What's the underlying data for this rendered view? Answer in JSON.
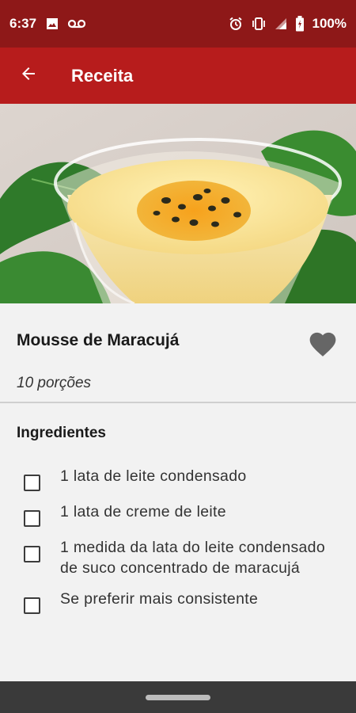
{
  "status_bar": {
    "time": "6:37",
    "battery": "100%",
    "icons": [
      "image-icon",
      "voicemail-icon",
      "alarm-icon",
      "vibrate-icon",
      "signal-icon",
      "battery-icon"
    ]
  },
  "app_bar": {
    "title": "Receita",
    "back_icon": "arrow-back-icon"
  },
  "recipe": {
    "title": "Mousse de Maracujá",
    "servings": "10 porções",
    "favorite_icon": "heart-icon"
  },
  "ingredients_section": {
    "title": "Ingredientes",
    "items": [
      {
        "text": "1 lata de leite condensado"
      },
      {
        "text": "1 lata de creme de leite"
      },
      {
        "text": "1 medida da lata do leite condensado de suco concentrado de maracujá"
      },
      {
        "text": "Se preferir mais consistente"
      }
    ]
  },
  "colors": {
    "status_bar": "#8e1818",
    "app_bar": "#b71c1c",
    "background": "#f2f2f2",
    "nav_bar": "#3a3a3a",
    "heart": "#666666"
  }
}
